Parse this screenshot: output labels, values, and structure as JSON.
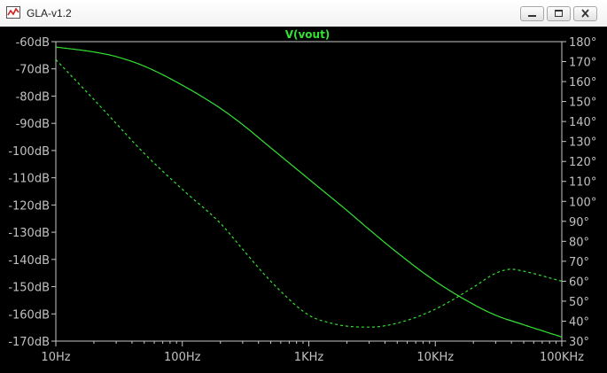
{
  "window": {
    "title": "GLA-v1.2",
    "controls": [
      "minimize",
      "maximize",
      "close"
    ],
    "app_icon": "chart-line-icon",
    "colors": {
      "background": "#000000",
      "trace": "#33e233",
      "axis": "#c8c8c8",
      "text": "#c0c0c0"
    }
  },
  "chart_data": {
    "type": "line",
    "title": "V(vout)",
    "x_scale": "log",
    "xlim": [
      10,
      100000
    ],
    "x_ticks": [
      10,
      100,
      1000,
      10000,
      100000
    ],
    "x_tick_labels": [
      "10Hz",
      "100Hz",
      "1KHz",
      "10KHz",
      "100KHz"
    ],
    "y_left_lim": [
      -170,
      -60
    ],
    "y_left_ticks": [
      -60,
      -70,
      -80,
      -90,
      -100,
      -110,
      -120,
      -130,
      -140,
      -150,
      -160,
      -170
    ],
    "y_left_tick_labels": [
      "-60dB",
      "-70dB",
      "-80dB",
      "-90dB",
      "-100dB",
      "-110dB",
      "-120dB",
      "-130dB",
      "-140dB",
      "-150dB",
      "-160dB",
      "-170dB"
    ],
    "y_right_lim": [
      30,
      180
    ],
    "y_right_ticks": [
      180,
      170,
      160,
      150,
      140,
      130,
      120,
      110,
      100,
      90,
      80,
      70,
      60,
      50,
      40,
      30
    ],
    "y_right_tick_labels": [
      "180°",
      "170°",
      "160°",
      "150°",
      "140°",
      "130°",
      "120°",
      "110°",
      "100°",
      "90°",
      "80°",
      "70°",
      "60°",
      "50°",
      "40°",
      "30°"
    ],
    "grid": false,
    "series": [
      {
        "axis": "left",
        "style": "solid",
        "x": [
          10,
          20,
          30,
          50,
          100,
          200,
          300,
          500,
          1000,
          2000,
          3000,
          5000,
          10000,
          20000,
          30000,
          50000,
          100000
        ],
        "y": [
          -62.0,
          -63.8,
          -65.5,
          -69.0,
          -76.0,
          -84.5,
          -90.5,
          -99.0,
          -110.5,
          -122.0,
          -129.0,
          -137.5,
          -148.0,
          -156.5,
          -160.5,
          -164.0,
          -168.5
        ]
      },
      {
        "axis": "right",
        "style": "dashed",
        "x": [
          10,
          20,
          30,
          50,
          100,
          200,
          300,
          500,
          1000,
          1500,
          2000,
          3000,
          5000,
          10000,
          20000,
          30000,
          40000,
          50000,
          100000
        ],
        "y": [
          171,
          151,
          139,
          124,
          106,
          89,
          76,
          60,
          43,
          39,
          37.5,
          37,
          39,
          46,
          57,
          64,
          66,
          65,
          60
        ]
      }
    ]
  }
}
